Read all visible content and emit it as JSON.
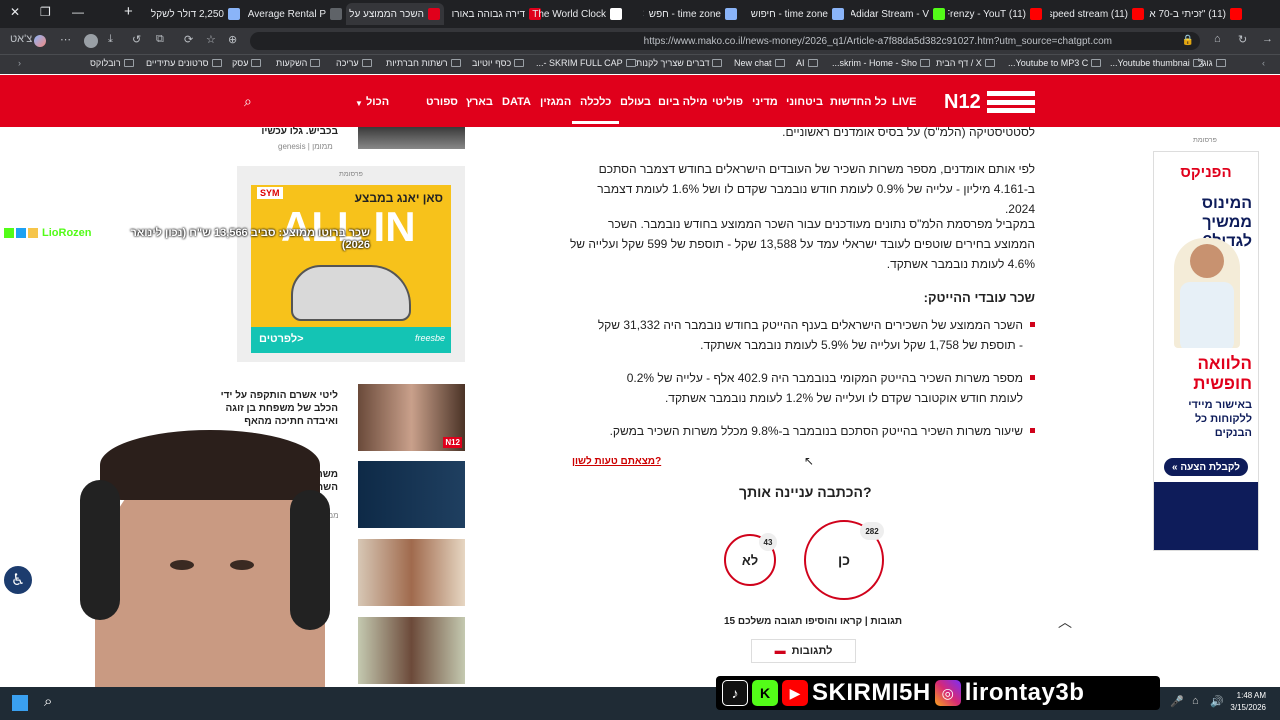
{
  "browser": {
    "tabs": [
      {
        "label": "2,250 דולר לשקל",
        "color": "#8ab4f8"
      },
      {
        "label": "Average Rental P",
        "color": "#5f6368"
      },
      {
        "label": "השכר הממוצע על",
        "color": "#e0001b",
        "active": true
      },
      {
        "label": "דירה גבוהה באורו",
        "color": "#e0001b"
      },
      {
        "label": "The World Clock",
        "color": "#ffffff"
      },
      {
        "label": "time zone - חפש",
        "color": "#8ab4f8"
      },
      {
        "label": "time zone - חיפוש",
        "color": "#8ab4f8"
      },
      {
        "label": "Adidar Stream - V",
        "color": "#53fc18"
      },
      {
        "label": "(11) Frenzy - YouT",
        "color": "#ff0000"
      },
      {
        "label": "(11) speed stream",
        "color": "#ff0000"
      },
      {
        "label": "(11) \"זכיתי ב-70 א",
        "color": "#ff0000"
      }
    ],
    "profile_label": "צ'אט",
    "url": "https://www.mako.co.il/news-money/2026_q1/Article-a7f88da5d382c91027.htm?utm_source=chatgpt.com",
    "bookmarks": [
      "גוגל",
      "Youtube thumbnai...",
      "Youtube to MP3 C...",
      "X / דף הבית",
      "skrim - Home - Sho...",
      "AI",
      "New chat",
      "דברים שצריך לקנות",
      "SKRIM FULL CAP -...",
      "כסף יוטיוב",
      "רשתות חברתיות",
      "עריכה",
      "השקעות",
      "עסק",
      "סרטונים עתידיים",
      "רובלוקס"
    ]
  },
  "site": {
    "logo": "N12",
    "nav": [
      "LIVE",
      "כל החדשות",
      "ביטחוני",
      "מדיני",
      "פוליטי",
      "מילה ביום",
      "בעולם",
      "כלכלה",
      "המגזין",
      "DATA",
      "בארץ",
      "ספורט",
      "הכול"
    ],
    "active_nav": "כלכלה"
  },
  "article": {
    "p0": "לסטטיסטיקה (הלמ\"ס) על בסיס אומדנים ראשוניים.",
    "p1": "לפי אותם אומדנים, מספר משרות השכיר של העובדים הישראלים בחודש דצמבר הסתכם ב-4.161 מיליון - עלייה של 0.9% לעומת חודש נובמבר שקדם לו ושל 1.6% לעומת דצמבר 2024.",
    "p2": "במקביל מפרסמת הלמ\"ס נתונים מעודכנים עבור השכר הממוצע בחודש נובמבר. השכר הממוצע בחירים שוטפים לעובד ישראלי עמד על 13,588 שקל - תוספת של 599 שקל ועלייה של 4.6% לעומת נובמבר אשתקד.",
    "subhead": "שכר עובדי ההייטק:",
    "b1": "השכר הממוצע של השכירים הישראלים בענף ההייטק בחודש נובמבר היה 31,332 שקל - תוספת של 1,758 שקל ועלייה של 5.9% לעומת נובמבר אשתקד.",
    "b2": "מספר משרות השכיר בהייטק המקומי בנובמבר היה 402.9 אלף - עלייה של 0.2% לעומת חודש אוקטובר שקדם לו ועלייה של 1.2% לעומת נובמבר אשתקד.",
    "b3": "שיעור משרות השכיר בהייטק הסתכם בנובמבר ב-9.8% מכלל משרות השכיר במשק.",
    "report": "מצאתם טעות לשון?"
  },
  "poll": {
    "question": "הכתבה עניינה אותך?",
    "yes_label": "כן",
    "yes_count": "282",
    "no_label": "לא",
    "no_count": "43",
    "responses": "15 תגובות | קראו והוסיפו תגובה משלכם",
    "comments_button": "לתגובות"
  },
  "sidebar": {
    "top_title": "בכביש. גלו עכשיו",
    "top_src": "genesis | ממומן",
    "ad_label": "פרסומת",
    "ad_left": {
      "headline1": "סאן יאנג במבצע",
      "headline2": "ALL IN",
      "cta": "לפרטים>",
      "brand": "SYM",
      "sub": "freesbe"
    },
    "items": [
      {
        "title": "ליטי אשרם הותקפה על ידי הכלב של משפחת בן זוגה ואיבדה חתיכה מהאף"
      },
      {
        "title": "משרד הא השרים ישרא",
        "src": "ממומן"
      }
    ]
  },
  "ad_right": {
    "label": "פרסומת",
    "brand": "הפניקס",
    "line1": "המינוס ממשיך לגדול?",
    "line2": "הלוואה חופשית",
    "line3": "באישור מיידי ללקוחות כל הבנקים",
    "cta": "לקבלת הצעה »"
  },
  "ticker": {
    "name": "LioRozen",
    "text": "שכר ברוטו ממוצע: סביב 13,566 ש\"ח (נכון לינואר 2026)"
  },
  "stream": {
    "handle1": "SKIRMI5H",
    "handle2": "lirontay3b"
  },
  "taskbar": {
    "time": "1:48 AM",
    "date": "3/15/2026"
  }
}
